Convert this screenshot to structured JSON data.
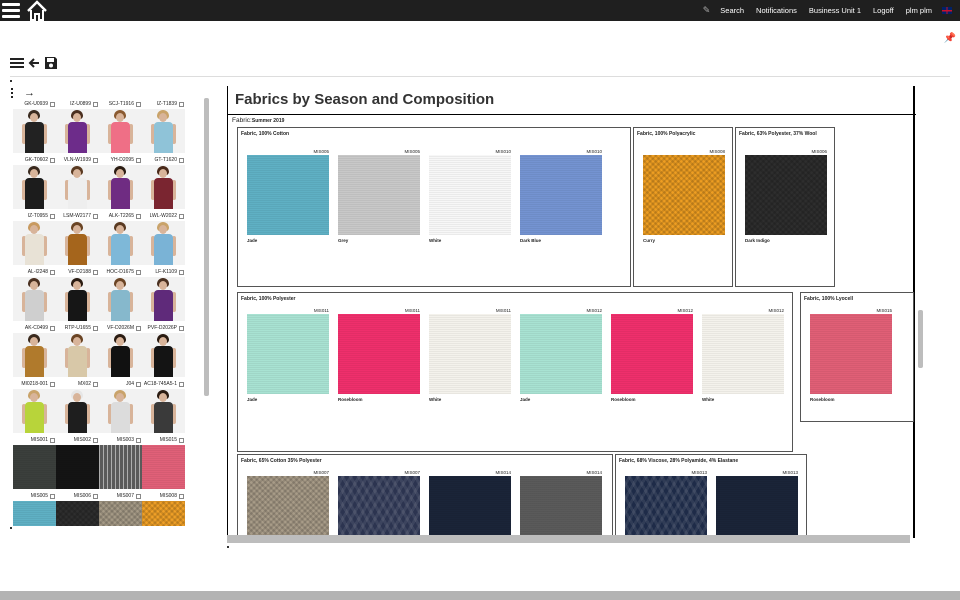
{
  "topbar": {
    "nav": [
      "Search",
      "Notifications",
      "Business Unit 1",
      "Logoff",
      "plm plm"
    ]
  },
  "left_panel": {
    "products": [
      {
        "label": "GK-U0939",
        "hair": "#3a2a1e",
        "top": "#222222"
      },
      {
        "label": "IZ-U0899",
        "hair": "#4a3020",
        "top": "#6d2c8a"
      },
      {
        "label": "SCJ-T1916",
        "hair": "#8a5a30",
        "top": "#ef6f86"
      },
      {
        "label": "IZ-T1839",
        "hair": "#c9a36a",
        "top": "#8fc3d8"
      },
      {
        "label": "GK-T0602",
        "hair": "#3a2a1e",
        "top": "#1c1c1c"
      },
      {
        "label": "VLN-W1939",
        "hair": "#5a3a22",
        "top": "#eeeeee"
      },
      {
        "label": "YH-D2095",
        "hair": "#2b1c12",
        "top": "#6f2c82"
      },
      {
        "label": "GT-T1620",
        "hair": "#4a2a1a",
        "top": "#7a2530"
      },
      {
        "label": "IZ-T0955",
        "hair": "#c89a60",
        "top": "#e8e2d6"
      },
      {
        "label": "LSM-W2177",
        "hair": "#6a4424",
        "top": "#a5651c"
      },
      {
        "label": "ALK-T2265",
        "hair": "#5a3a22",
        "top": "#7eb8d8"
      },
      {
        "label": "LWL-W2022",
        "hair": "#c9a36a",
        "top": "#7ab3d6"
      },
      {
        "label": "AL-I2248",
        "hair": "#4a3020",
        "top": "#cfcfcf"
      },
      {
        "label": "VF-D2188",
        "hair": "#2b1c12",
        "top": "#161616"
      },
      {
        "label": "HOC-D1675",
        "hair": "#6a4424",
        "top": "#86b8cc"
      },
      {
        "label": "LF-K1109",
        "hair": "#4a3020",
        "top": "#5f2a7a"
      },
      {
        "label": "AK-C0499",
        "hair": "#3a2a1e",
        "top": "#b07a2c"
      },
      {
        "label": "RTP-U1655",
        "hair": "#6a4424",
        "top": "#d8c8a8"
      },
      {
        "label": "VF-D2026M",
        "hair": "#2b1c12",
        "top": "#111111"
      },
      {
        "label": "PVF-D2026P",
        "hair": "#2b1c12",
        "top": "#141414"
      },
      {
        "label": "MI0218-001",
        "hair": "#c9a36a",
        "top": "#b8d43a"
      },
      {
        "label": "MX02",
        "hair": "#e6e6e6",
        "top": "#1e1e1e"
      },
      {
        "label": "J04",
        "hair": "#c9a36a",
        "top": "#dcdcdc"
      },
      {
        "label": "AC18-745A5-1",
        "hair": "#2b1c12",
        "top": "#3a3a3a"
      }
    ],
    "materials": [
      {
        "label": "MIS001",
        "color": "#3b3f3c",
        "texture": "tex-fine"
      },
      {
        "label": "MIS002",
        "color": "#141414",
        "texture": "tex-fine"
      },
      {
        "label": "MIS003",
        "color": "#5a5a5a",
        "texture": "tex-stripe"
      },
      {
        "label": "MIS015",
        "color": "#e06078",
        "texture": "tex-fine"
      },
      {
        "label": "MIS005",
        "color": "#5fb0c4",
        "texture": "tex-fine"
      },
      {
        "label": "MIS006",
        "color": "#2e2e2e",
        "texture": "tex-knit"
      },
      {
        "label": "MIS007",
        "color": "#a59a86",
        "texture": "tex-knit"
      },
      {
        "label": "MIS008",
        "color": "#f0a027",
        "texture": "tex-knit"
      }
    ]
  },
  "report": {
    "title": "Fabrics by Season and Composition",
    "fabric_label": "Fabric:",
    "season": "Summer 2019",
    "groups": [
      {
        "title": "Fabric, 100% Cotton",
        "items": [
          {
            "code": "MIS005",
            "name": "Jade",
            "color": "#5fb0c4",
            "texture": "tex-fine"
          },
          {
            "code": "MIS005",
            "name": "Grey",
            "color": "#c8c8c8",
            "texture": "tex-fine"
          },
          {
            "code": "MIS010",
            "name": "White",
            "color": "#f7f7f7",
            "texture": "tex-fine"
          },
          {
            "code": "MIS010",
            "name": "Dark Blue",
            "color": "#7493d1",
            "texture": "tex-fine"
          }
        ]
      },
      {
        "title": "Fabric, 100% Polyacrylic",
        "items": [
          {
            "code": "MIS008",
            "name": "Curry",
            "color": "#ee9e22",
            "texture": "tex-knit"
          }
        ]
      },
      {
        "title": "Fabric, 63% Polyester, 37% Wool",
        "items": [
          {
            "code": "MIS006",
            "name": "Dark Indigo",
            "color": "#2e2e2e",
            "texture": "tex-knit"
          }
        ]
      },
      {
        "title": "Fabric, 100% Polyester",
        "items": [
          {
            "code": "MIS011",
            "name": "Jade",
            "color": "#a8e2d2",
            "texture": "tex-fine"
          },
          {
            "code": "MIS011",
            "name": "Rosebloom",
            "color": "#ef2f6c",
            "texture": "tex-fine"
          },
          {
            "code": "MIS011",
            "name": "White",
            "color": "#f4f2ec",
            "texture": "tex-fine"
          },
          {
            "code": "MIS012",
            "name": "Jade",
            "color": "#a8e2d2",
            "texture": "tex-fine"
          },
          {
            "code": "MIS012",
            "name": "Rosebloom",
            "color": "#ef2f6c",
            "texture": "tex-fine"
          },
          {
            "code": "MIS012",
            "name": "White",
            "color": "#f4f2ec",
            "texture": "tex-fine"
          }
        ]
      },
      {
        "title": "Fabric, 100% Lyocell",
        "items": [
          {
            "code": "MIS015",
            "name": "Rosebloom",
            "color": "#e05f76",
            "texture": "tex-fine"
          }
        ]
      },
      {
        "title": "Fabric, 65% Cotton 35% Polyester",
        "items": [
          {
            "code": "MIS007",
            "name": "",
            "color": "#a89c88",
            "texture": "tex-knit"
          },
          {
            "code": "MIS007",
            "name": "",
            "color": "#2c3450",
            "texture": "tex-cable"
          },
          {
            "code": "MIS014",
            "name": "",
            "color": "#1a2438",
            "texture": "tex-fine"
          },
          {
            "code": "MIS014",
            "name": "",
            "color": "#5a5a5a",
            "texture": "tex-fine"
          }
        ]
      },
      {
        "title": "Fabric, 68% Viscose, 28% Polyamide, 4% Elastane",
        "items": [
          {
            "code": "MIS013",
            "name": "",
            "color": "#1e2b48",
            "texture": "tex-cable"
          },
          {
            "code": "MIS013",
            "name": "",
            "color": "#1a2438",
            "texture": "tex-fine"
          }
        ]
      }
    ]
  }
}
